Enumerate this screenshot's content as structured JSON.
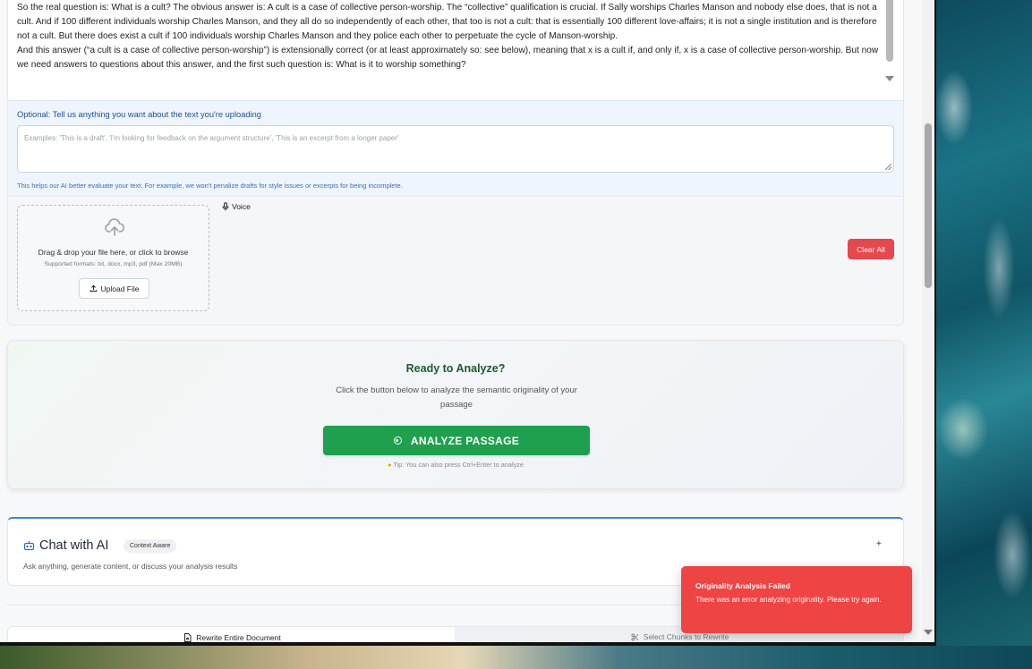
{
  "passage": {
    "lines": [
      "So the real question is: What is a cult? The obvious answer is: A cult is a case of collective person-worship. The “collective” qualification is crucial. If Sally worships Charles Manson and nobody else does, that is not a cult. And if 100 different individuals worship Charles Manson, and they all do so independently of each other, that too is not a cult: that is essentially 100 different love-affairs; it is not a single institution and is therefore not a cult.  But there does exist a cult if 100 individuals worship Charles Manson and they police each other to perpetuate the cycle of Manson-worship.",
      "And this answer (“a cult is a case of collective person-worship”) is extensionally correct (or at least approximately so: see below), meaning that x is a cult if, and only if, x is a case of collective person-worship. But now we need answers to questions about this answer, and the first such question is: What is it to worship something?"
    ]
  },
  "context": {
    "label": "Optional: Tell us anything you want about the text you're uploading",
    "placeholder": "Examples: 'This is a draft', 'I'm looking for feedback on the argument structure', 'This is an excerpt from a longer paper'",
    "help": "This helps our AI better evaluate your text. For example, we won't penalize drafts for style issues or excerpts for being incomplete."
  },
  "upload": {
    "title": "Drag & drop your file here, or click to browse",
    "formats": "Supported formats: txt, docx, mp3, pdf (Max 20MB)",
    "button": "Upload File",
    "voice": "Voice",
    "clear": "Clear All"
  },
  "analyze": {
    "title": "Ready to Analyze?",
    "subtitle": "Click the button below to analyze the semantic originality of your passage",
    "button": "ANALYZE PASSAGE",
    "tip": "Tip: You can also press Ctrl+Enter to analyze"
  },
  "chat": {
    "title": "Chat with AI",
    "badge": "Context Aware",
    "expand": "+",
    "subtitle": "Ask anything, generate content, or discuss your analysis results"
  },
  "rewrite": {
    "tab_entire": "Rewrite Entire Document",
    "tab_chunks": "Select Chunks to Rewrite"
  },
  "toast": {
    "title": "Originality Analysis Failed",
    "message": "There was an error analyzing originality. Please try again."
  },
  "colors": {
    "analyze_green": "#1ea04e",
    "clear_red": "#e5484d",
    "toast_red": "#ef4444",
    "chat_accent": "#3a86d8"
  }
}
